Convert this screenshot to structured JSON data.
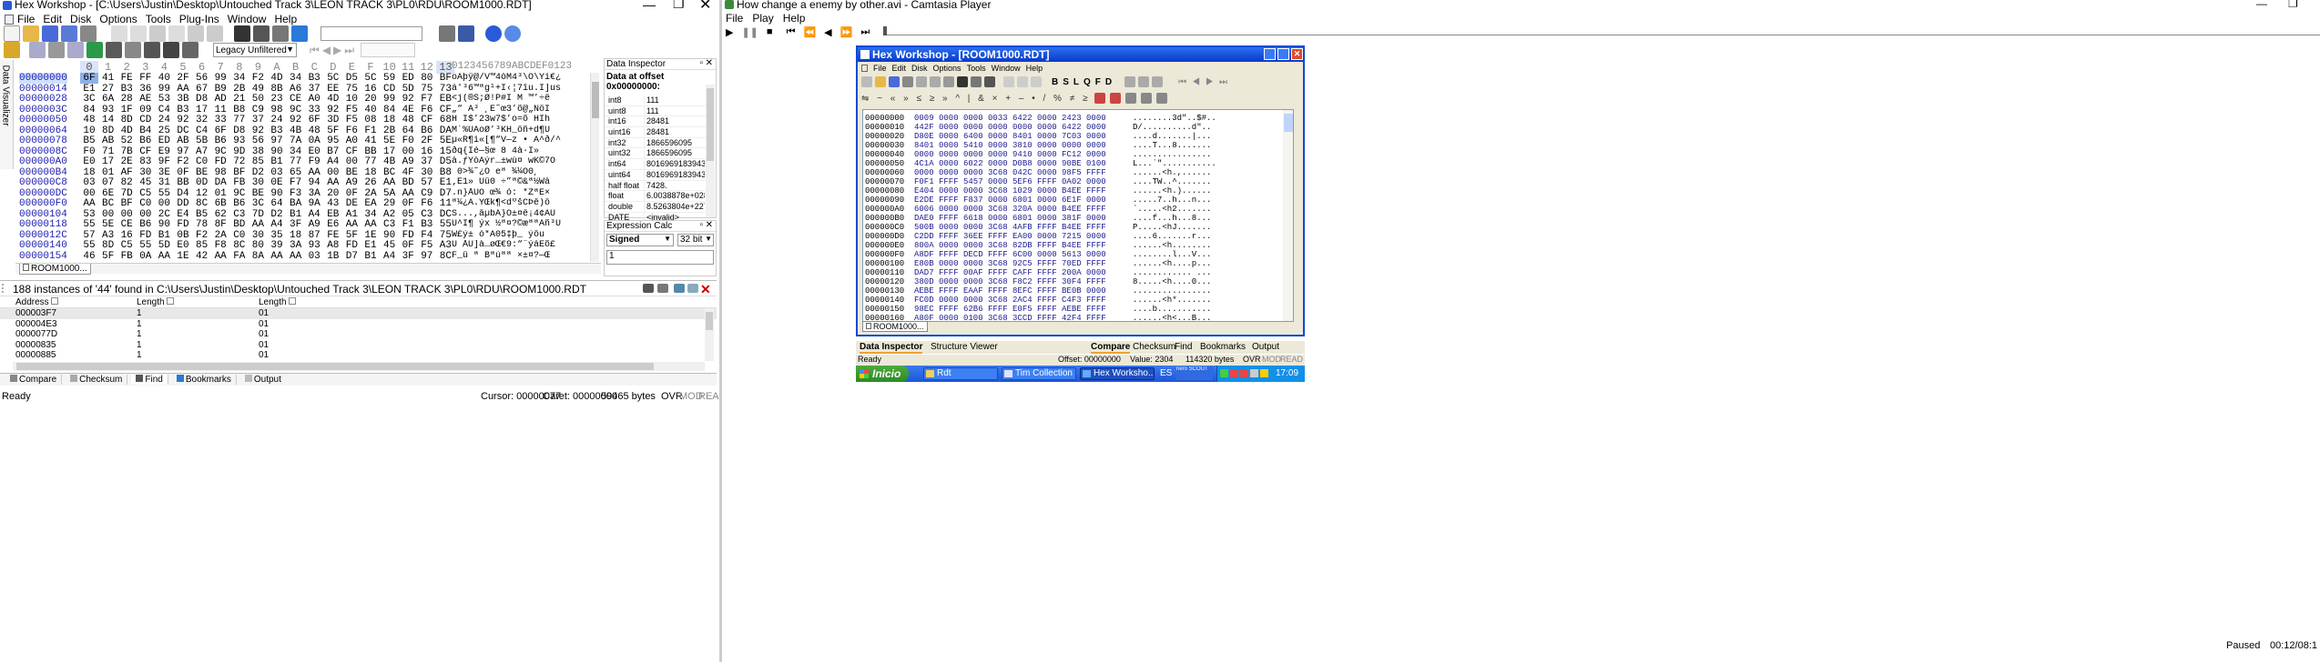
{
  "left": {
    "title": "Hex Workshop - [C:\\Users\\Justin\\Desktop\\Untouched Track 3\\LEON TRACK 3\\PL0\\RDU\\ROOM1000.RDT]",
    "menu": [
      "File",
      "Edit",
      "Disk",
      "Options",
      "Tools",
      "Plug-Ins",
      "Window",
      "Help"
    ],
    "charset": "Legacy Unfiltered",
    "col_headers": [
      "0",
      "1",
      "2",
      "3",
      "4",
      "5",
      "6",
      "7",
      "8",
      "9",
      "A",
      "B",
      "C",
      "D",
      "E",
      "F",
      "10",
      "11",
      "12",
      "13"
    ],
    "ascii_header": "0123456789ABCDEF0123",
    "side_tab": "Data Visualizer",
    "rows": [
      {
        "addr": "00000000",
        "hex": [
          "6F",
          "41",
          "FE",
          "FF",
          "40",
          "2F",
          "56",
          "99",
          "34",
          "F2",
          "4D",
          "34",
          "B3",
          "5C",
          "D5",
          "5C",
          "59",
          "ED",
          "80",
          "BF"
        ],
        "ascii": "oAþÿ@/V™4òM4³\\Õ\\Yí€¿"
      },
      {
        "addr": "00000014",
        "hex": [
          "E1",
          "27",
          "B3",
          "36",
          "99",
          "AA",
          "67",
          "B9",
          "2B",
          "49",
          "8B",
          "A6",
          "37",
          "EE",
          "75",
          "16",
          "CD",
          "5D",
          "75",
          "73"
        ],
        "ascii": "á'³6™ªg¹+I‹¦7îu.Í]us"
      },
      {
        "addr": "00000028",
        "hex": [
          "3C",
          "6A",
          "28",
          "AE",
          "53",
          "3B",
          "D8",
          "AD",
          "21",
          "50",
          "23",
          "CE",
          "A0",
          "4D",
          "10",
          "20",
          "99",
          "92",
          "F7",
          "EB"
        ],
        "ascii": "<j(®S;Ø­!P#Î M ™’÷ë"
      },
      {
        "addr": "0000003C",
        "hex": [
          "84",
          "93",
          "1F",
          "09",
          "C4",
          "B3",
          "17",
          "11",
          "B8",
          "C9",
          "98",
          "9C",
          "33",
          "92",
          "F5",
          "40",
          "84",
          "4E",
          "F6",
          "CF"
        ],
        "ascii": "„“ Ä³ ¸É˜œ3’õ@„NöÏ"
      },
      {
        "addr": "00000050",
        "hex": [
          "48",
          "14",
          "8D",
          "CD",
          "24",
          "92",
          "32",
          "33",
          "77",
          "37",
          "24",
          "92",
          "6F",
          "3D",
          "F5",
          "08",
          "18",
          "48",
          "CF",
          "68"
        ],
        "ascii": "H Í$’23w7$’o=õ HÏh"
      },
      {
        "addr": "00000064",
        "hex": [
          "10",
          "8D",
          "4D",
          "B4",
          "25",
          "DC",
          "C4",
          "6F",
          "D8",
          "92",
          "B3",
          "4B",
          "48",
          "5F",
          "F6",
          "F1",
          "2B",
          "64",
          "B6",
          "DA"
        ],
        "ascii": " M´%ÜÄoØ’³KH_öñ+d¶Ú"
      },
      {
        "addr": "00000078",
        "hex": [
          "B5",
          "AB",
          "52",
          "B6",
          "ED",
          "AB",
          "5B",
          "B6",
          "93",
          "56",
          "97",
          "7A",
          "0A",
          "95",
          "A0",
          "41",
          "5E",
          "F0",
          "2F",
          "5E"
        ],
        "ascii": "µ«R¶í«[¶“V—z • A^ð/^"
      },
      {
        "addr": "0000008C",
        "hex": [
          "F0",
          "71",
          "7B",
          "CF",
          "E9",
          "97",
          "A7",
          "9C",
          "9D",
          "38",
          "90",
          "34",
          "E0",
          "B7",
          "CF",
          "BB",
          "17",
          "00",
          "16",
          "15"
        ],
        "ascii": "ðq{Ïé—§œ 8 4à·Ï»"
      },
      {
        "addr": "000000A0",
        "hex": [
          "E0",
          "17",
          "2E",
          "83",
          "9F",
          "F2",
          "C0",
          "FD",
          "72",
          "85",
          "B1",
          "77",
          "F9",
          "A4",
          "00",
          "77",
          "4B",
          "A9",
          "37",
          "D5"
        ],
        "ascii": "à.ƒŸòÀýr…±wù¤ wK©7Õ"
      },
      {
        "addr": "000000B4",
        "hex": [
          "18",
          "01",
          "AF",
          "30",
          "3E",
          "0F",
          "BE",
          "98",
          "BF",
          "D2",
          "03",
          "65",
          "AA",
          "00",
          "BE",
          "18",
          "BC",
          "4F",
          "30",
          "B8"
        ],
        "ascii": " ¯0>¾˜¿Ò eª ¾¼O0¸"
      },
      {
        "addr": "000000C8",
        "hex": [
          "03",
          "07",
          "82",
          "45",
          "31",
          "BB",
          "0D",
          "DA",
          "FB",
          "30",
          "0E",
          "F7",
          "94",
          "AA",
          "A9",
          "26",
          "AA",
          "BD",
          "57",
          "E1"
        ],
        "ascii": "‚E1» Úû0 ÷”ª©&ª½Wá"
      },
      {
        "addr": "000000DC",
        "hex": [
          "00",
          "6E",
          "7D",
          "C5",
          "55",
          "D4",
          "12",
          "01",
          "9C",
          "BE",
          "90",
          "F3",
          "3A",
          "20",
          "0F",
          "2A",
          "5A",
          "AA",
          "C9",
          "D7"
        ],
        "ascii": ".n}ÅUÔ œ¾ ó: *ZªÉ×"
      },
      {
        "addr": "000000F0",
        "hex": [
          "AA",
          "BC",
          "BF",
          "C0",
          "00",
          "DD",
          "8C",
          "6B",
          "B6",
          "3C",
          "64",
          "BA",
          "9A",
          "43",
          "DE",
          "EA",
          "29",
          "0F",
          "F6",
          "11"
        ],
        "ascii": "ª¼¿À.ÝŒk¶<dºšCÞê)ö"
      },
      {
        "addr": "00000104",
        "hex": [
          "53",
          "00",
          "00",
          "00",
          "2C",
          "E4",
          "B5",
          "62",
          "C3",
          "7D",
          "D2",
          "B1",
          "A4",
          "EB",
          "A1",
          "34",
          "A2",
          "05",
          "C3",
          "DC"
        ],
        "ascii": "S...,äµbÃ}Ò±¤ë¡4¢ÃÜ"
      },
      {
        "addr": "00000118",
        "hex": [
          "55",
          "5E",
          "CE",
          "B6",
          "90",
          "FD",
          "78",
          "8F",
          "BD",
          "AA",
          "A4",
          "3F",
          "A9",
          "E6",
          "AA",
          "AA",
          "C3",
          "F1",
          "B3",
          "55"
        ],
        "ascii": "U^Î¶ ýx ½ª¤?©æªªÃñ³U"
      },
      {
        "addr": "0000012C",
        "hex": [
          "57",
          "A3",
          "16",
          "FD",
          "B1",
          "0B",
          "F2",
          "2A",
          "C0",
          "30",
          "35",
          "18",
          "87",
          "FE",
          "5F",
          "1E",
          "90",
          "FD",
          "F4",
          "75"
        ],
        "ascii": "W£ý± ò*À05‡þ_ ýôu"
      },
      {
        "addr": "00000140",
        "hex": [
          "55",
          "8D",
          "C5",
          "55",
          "5D",
          "E0",
          "85",
          "F8",
          "8C",
          "80",
          "39",
          "3A",
          "93",
          "A8",
          "FD",
          "E1",
          "45",
          "0F",
          "F5",
          "A3"
        ],
        "ascii": "U ÅU]à…øŒ€9:“¨ýáEõ£"
      },
      {
        "addr": "00000154",
        "hex": [
          "46",
          "5F",
          "FB",
          "0A",
          "AA",
          "1E",
          "42",
          "AA",
          "FA",
          "8A",
          "AA",
          "AA",
          "03",
          "1B",
          "D7",
          "B1",
          "A4",
          "3F",
          "97",
          "8C"
        ],
        "ascii": "F_û ª Bªúªª ×±¤?—Œ"
      }
    ],
    "doc_tab": "ROOM1000...",
    "inspector": {
      "title": "Data Inspector",
      "offset_label": "Data at offset 0x00000000:",
      "rows": [
        [
          "int8",
          "111"
        ],
        [
          "uint8",
          "111"
        ],
        [
          "int16",
          "28481"
        ],
        [
          "uint16",
          "28481"
        ],
        [
          "int32",
          "1866596095"
        ],
        [
          "uint32",
          "1866596095"
        ],
        [
          "int64",
          "8016969183943..."
        ],
        [
          "uint64",
          "8016969183943..."
        ],
        [
          "half float",
          "7428."
        ],
        [
          "float",
          "6.0038878e+028"
        ],
        [
          "double",
          "8.5263804e+227"
        ],
        [
          "DATE",
          "<invalid>"
        ]
      ]
    },
    "calc": {
      "title": "Expression Calc",
      "sign": "Signed",
      "bits": "32 bit",
      "value": "1"
    },
    "results": {
      "title": "188 instances of '44' found in C:\\Users\\Justin\\Desktop\\Untouched Track 3\\LEON TRACK 3\\PL0\\RDU\\ROOM1000.RDT",
      "cols": [
        "Address",
        "Length",
        "Length"
      ],
      "rows": [
        [
          "000003F7",
          "1",
          "01"
        ],
        [
          "000004E3",
          "1",
          "01"
        ],
        [
          "0000077D",
          "1",
          "01"
        ],
        [
          "00000835",
          "1",
          "01"
        ],
        [
          "00000885",
          "1",
          "01"
        ]
      ]
    },
    "bottom_tabs": [
      "Compare",
      "Checksum",
      "Find",
      "Bookmarks",
      "Output"
    ],
    "status": {
      "ready": "Ready",
      "cursor": "Cursor: 00000077",
      "caret": "Caret: 00000000",
      "size": "59465 bytes",
      "ovr": "OVR",
      "mod": "MOD",
      "read": "READ"
    }
  },
  "right": {
    "title": "How change a enemy by other.avi - Camtasia Player",
    "menu": [
      "File",
      "Play",
      "Help"
    ],
    "inner": {
      "title": "Hex Workshop - [ROOM1000.RDT]",
      "menu": [
        "File",
        "Edit",
        "Disk",
        "Options",
        "Tools",
        "Window",
        "Help"
      ],
      "rows": [
        [
          "00000000",
          "0009 0000 0000 0033 6422 0000 2423 0000",
          "........3d\"..$#.."
        ],
        [
          "00000010",
          "442F 0000 0000 0000 0000 0000 6422 0000",
          "D/..........d\".."
        ],
        [
          "00000020",
          "D80E 0000 6400 0000 8401 0000 7C03 0000",
          "....d.......|..."
        ],
        [
          "00000030",
          "8401 0000 5410 0000 3810 0000 0000 0000",
          "....T...8......."
        ],
        [
          "00000040",
          "0000 0000 0000 0000 9410 0000 FC12 0000",
          "................"
        ],
        [
          "00000050",
          "4C1A 0000 6022 0000 D0B8 0000 90BE 0100",
          "L...`\"..........."
        ],
        [
          "00000060",
          "0000 0000 0000 3C68 042C 0000 98F5 FFFF",
          "......<h.,......"
        ],
        [
          "00000070",
          "F0F1 FFFF 5457 0000 5EF6 FFFF 0A02 0000",
          "....TW..^......."
        ],
        [
          "00000080",
          "E404 0000 0000 3C68 1029 0000 B4EE FFFF",
          "......<h.)......"
        ],
        [
          "00000090",
          "E2DE FFFF F837 0000 6801 0000 6E1F 0000",
          ".....7..h...n..."
        ],
        [
          "000000A0",
          "6006 0000 0000 3C68 320A 0000 B4EE FFFF",
          "`.....<h2......."
        ],
        [
          "000000B0",
          "DAE0 FFFF 6618 0000 6801 0000 381F 0000",
          "....f...h...8..."
        ],
        [
          "000000C0",
          "500B 0000 0000 3C68 4AFB FFFF B4EE FFFF",
          "P.....<hJ......."
        ],
        [
          "000000D0",
          "C2DD FFFF 36EE FFFF EA00 0000 7215 0000",
          "....6.......r..."
        ],
        [
          "000000E0",
          "800A 0000 0000 3C68 82DB FFFF B4EE FFFF",
          "......<h........"
        ],
        [
          "000000F0",
          "A8DF FFFF DECD FFFF 6C00 0000 5613 0000",
          "........l...V..."
        ],
        [
          "00000100",
          "E80B 0000 0000 3C68 92C5 FFFF 70ED FFFF",
          "......<h....p..."
        ],
        [
          "00000110",
          "DAD7 FFFF 00AF FFFF CAFF FFFF 200A 0000",
          "............ ..."
        ],
        [
          "00000120",
          "380D 0000 0000 3C68 F8C2 FFFF 30F4 FFFF",
          "8.....<h....0..."
        ],
        [
          "00000130",
          "AEBE FFFF EAAF FFFF 8EFC FFFF BE0B 0000",
          "................"
        ],
        [
          "00000140",
          "FC0D 0000 0000 3C68 2AC4 FFFF C4F3 FFFF",
          "......<h*......."
        ],
        [
          "00000150",
          "98EC FFFF 62B6 FFFF E0F5 FFFF AEBE FFFF",
          "....b..........."
        ],
        [
          "00000160",
          "A80F 0000 0100 3C68 3CCD FFFF 42F4 FFFF",
          "......<h<...B..."
        ]
      ],
      "doc_tab": "ROOM1000...",
      "panel_tabs_left": [
        "Data Inspector",
        "Structure Viewer"
      ],
      "panel_tabs_right": [
        "Compare",
        "Checksum",
        "Find",
        "Bookmarks",
        "Output"
      ],
      "status": {
        "ready": "Ready",
        "offset": "Offset: 00000000",
        "value": "Value: 2304",
        "size": "114320 bytes",
        "ovr": "OVR",
        "mod": "MOD",
        "read": "READ"
      }
    },
    "taskbar": {
      "start": "Inicio",
      "items": [
        "Rdt",
        "Tim Collection",
        "Hex Worksho..."
      ],
      "lang": "ES",
      "tray": "nero SCOUT",
      "clock": "17:09"
    },
    "player_status": {
      "state": "Paused",
      "time": "00:12/08:1"
    }
  }
}
